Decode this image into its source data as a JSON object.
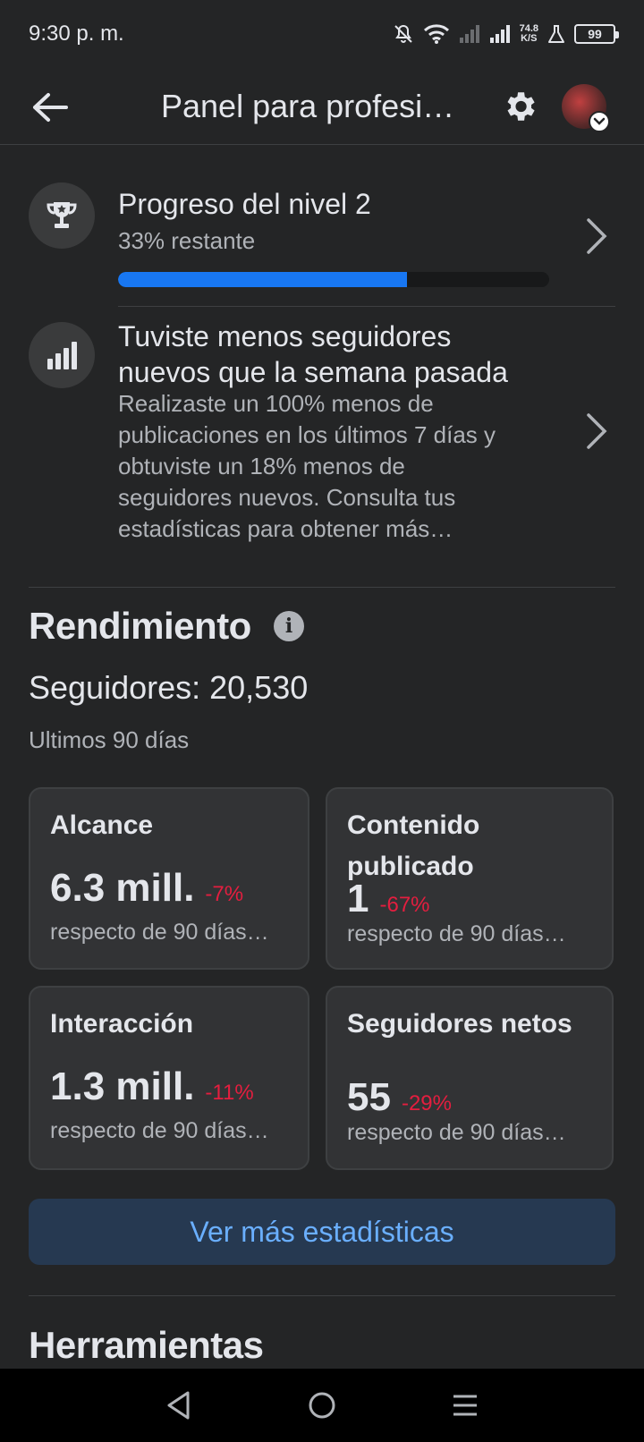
{
  "status_bar": {
    "time": "9:30 p. m.",
    "net_speed_value": "74.8",
    "net_speed_unit": "K/S",
    "battery": "99",
    "icons": [
      "bell-off-icon",
      "wifi-icon",
      "signal-weak-icon",
      "signal-strong-icon",
      "flask-icon",
      "battery-icon"
    ]
  },
  "app_bar": {
    "title": "Panel para profesi…",
    "icons": [
      "back-arrow-icon",
      "gear-icon",
      "avatar",
      "chevron-down-icon"
    ]
  },
  "level": {
    "title": "Progreso del nivel 2",
    "subtitle": "33% restante",
    "progress_fraction": 0.67,
    "icon": "trophy-icon"
  },
  "insight": {
    "title": "Tuviste menos seguidores nuevos que la semana pasada",
    "body": "Realizaste un 100% menos de publicaciones en los últimos 7 días y obtuviste un 18% menos de seguidores nuevos. Consulta tus estadísticas para obtener más…",
    "icon": "bar-chart-icon"
  },
  "performance": {
    "title": "Rendimiento",
    "followers": "Seguidores: 20,530",
    "period": "Ultimos 90 días",
    "cards": [
      {
        "label": "Alcance",
        "value": "6.3 mill.",
        "change": "-7%",
        "note": "respecto de 90 días…"
      },
      {
        "label": "Contenido publicado",
        "value": "1",
        "change": "-67%",
        "note": "respecto de 90 días…"
      },
      {
        "label": "Interacción",
        "value": "1.3 mill.",
        "change": "-11%",
        "note": "respecto de 90 días…"
      },
      {
        "label": "Seguidores netos",
        "value": "55",
        "change": "-29%",
        "note": "respecto de 90 días…"
      }
    ],
    "cta": "Ver más estadísticas"
  },
  "tools": {
    "title": "Herramientas"
  },
  "colors": {
    "background": "#242526",
    "card": "#323335",
    "accent": "#1877f2",
    "negative": "#e41e3f",
    "cta_text": "#6aafff"
  }
}
